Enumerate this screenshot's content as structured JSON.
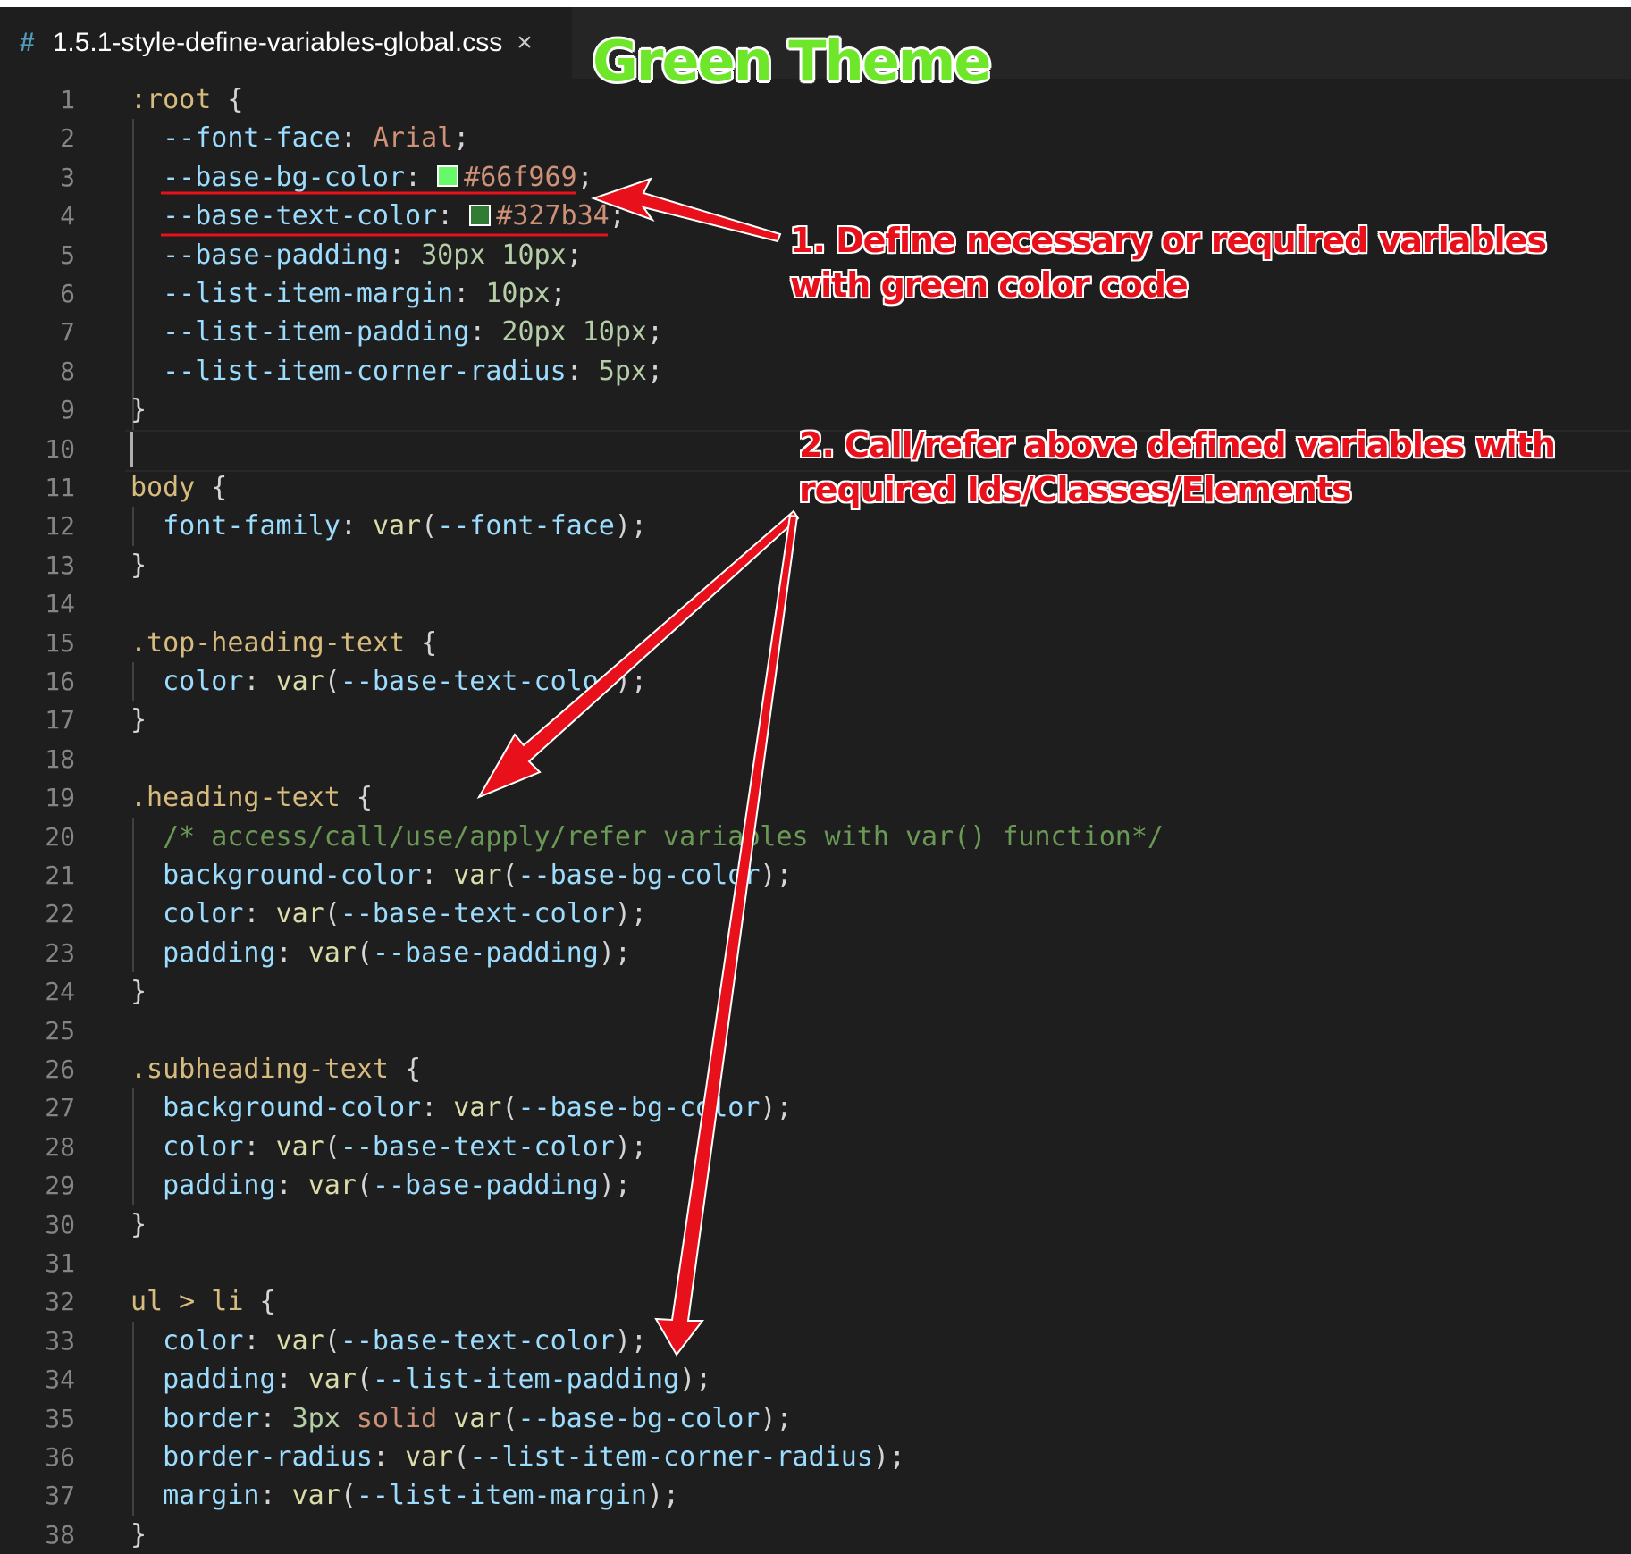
{
  "tab": {
    "icon": "css-hash-icon",
    "hash": "#",
    "filename": "1.5.1-style-define-variables-global.css",
    "close": "×"
  },
  "theme_label": "Green Theme",
  "annotations": {
    "note1_line1": "1.  Define necessary or required variables",
    "note1_line2": "with green color code",
    "note2_line1": "2. Call/refer above defined variables with",
    "note2_line2": "required Ids/Classes/Elements",
    "color": "#e8101a"
  },
  "swatches": {
    "base_bg": "#66f969",
    "base_text": "#327b34"
  },
  "lines": [
    {
      "n": "1",
      "t": [
        [
          ":root",
          "sel"
        ],
        [
          " {",
          "punc"
        ]
      ]
    },
    {
      "n": "2",
      "t": [
        [
          "  --font-face",
          "prop"
        ],
        [
          ": ",
          "punc"
        ],
        [
          "Arial",
          "val"
        ],
        [
          ";",
          "punc"
        ]
      ]
    },
    {
      "n": "3",
      "t": [
        [
          "  --base-bg-color",
          "prop"
        ],
        [
          ": ",
          "punc"
        ],
        [
          "#66f969",
          "val",
          "#66f969"
        ],
        [
          ";",
          "punc"
        ]
      ]
    },
    {
      "n": "4",
      "t": [
        [
          "  --base-text-color",
          "prop"
        ],
        [
          ": ",
          "punc"
        ],
        [
          "#327b34",
          "val",
          "#327b34"
        ],
        [
          ";",
          "punc"
        ]
      ]
    },
    {
      "n": "5",
      "t": [
        [
          "  --base-padding",
          "prop"
        ],
        [
          ": ",
          "punc"
        ],
        [
          "30px 10px",
          "num"
        ],
        [
          ";",
          "punc"
        ]
      ]
    },
    {
      "n": "6",
      "t": [
        [
          "  --list-item-margin",
          "prop"
        ],
        [
          ": ",
          "punc"
        ],
        [
          "10px",
          "num"
        ],
        [
          ";",
          "punc"
        ]
      ]
    },
    {
      "n": "7",
      "t": [
        [
          "  --list-item-padding",
          "prop"
        ],
        [
          ": ",
          "punc"
        ],
        [
          "20px 10px",
          "num"
        ],
        [
          ";",
          "punc"
        ]
      ]
    },
    {
      "n": "8",
      "t": [
        [
          "  --list-item-corner-radius",
          "prop"
        ],
        [
          ": ",
          "punc"
        ],
        [
          "5px",
          "num"
        ],
        [
          ";",
          "punc"
        ]
      ]
    },
    {
      "n": "9",
      "t": [
        [
          "}",
          "punc"
        ]
      ]
    },
    {
      "n": "10",
      "t": []
    },
    {
      "n": "11",
      "t": [
        [
          "body",
          "sel"
        ],
        [
          " {",
          "punc"
        ]
      ]
    },
    {
      "n": "12",
      "t": [
        [
          "  font-family",
          "prop"
        ],
        [
          ": ",
          "punc"
        ],
        [
          "var",
          "fn"
        ],
        [
          "(",
          "punc"
        ],
        [
          "--font-face",
          "prop"
        ],
        [
          ");",
          "punc"
        ]
      ]
    },
    {
      "n": "13",
      "t": [
        [
          "}",
          "punc"
        ]
      ]
    },
    {
      "n": "14",
      "t": []
    },
    {
      "n": "15",
      "t": [
        [
          ".top-heading-text",
          "sel"
        ],
        [
          " {",
          "punc"
        ]
      ]
    },
    {
      "n": "16",
      "t": [
        [
          "  color",
          "prop"
        ],
        [
          ": ",
          "punc"
        ],
        [
          "var",
          "fn"
        ],
        [
          "(",
          "punc"
        ],
        [
          "--base-text-color",
          "prop"
        ],
        [
          ");",
          "punc"
        ]
      ]
    },
    {
      "n": "17",
      "t": [
        [
          "}",
          "punc"
        ]
      ]
    },
    {
      "n": "18",
      "t": []
    },
    {
      "n": "19",
      "t": [
        [
          ".heading-text",
          "sel"
        ],
        [
          " {",
          "punc"
        ]
      ]
    },
    {
      "n": "20",
      "t": [
        [
          "  /* access/call/use/apply/refer variables with var() function*/",
          "com"
        ]
      ]
    },
    {
      "n": "21",
      "t": [
        [
          "  background-color",
          "prop"
        ],
        [
          ": ",
          "punc"
        ],
        [
          "var",
          "fn"
        ],
        [
          "(",
          "punc"
        ],
        [
          "--base-bg-color",
          "prop"
        ],
        [
          ");",
          "punc"
        ]
      ]
    },
    {
      "n": "22",
      "t": [
        [
          "  color",
          "prop"
        ],
        [
          ": ",
          "punc"
        ],
        [
          "var",
          "fn"
        ],
        [
          "(",
          "punc"
        ],
        [
          "--base-text-color",
          "prop"
        ],
        [
          ");",
          "punc"
        ]
      ]
    },
    {
      "n": "23",
      "t": [
        [
          "  padding",
          "prop"
        ],
        [
          ": ",
          "punc"
        ],
        [
          "var",
          "fn"
        ],
        [
          "(",
          "punc"
        ],
        [
          "--base-padding",
          "prop"
        ],
        [
          ");",
          "punc"
        ]
      ]
    },
    {
      "n": "24",
      "t": [
        [
          "}",
          "punc"
        ]
      ]
    },
    {
      "n": "25",
      "t": []
    },
    {
      "n": "26",
      "t": [
        [
          ".subheading-text",
          "sel"
        ],
        [
          " {",
          "punc"
        ]
      ]
    },
    {
      "n": "27",
      "t": [
        [
          "  background-color",
          "prop"
        ],
        [
          ": ",
          "punc"
        ],
        [
          "var",
          "fn"
        ],
        [
          "(",
          "punc"
        ],
        [
          "--base-bg-color",
          "prop"
        ],
        [
          ");",
          "punc"
        ]
      ]
    },
    {
      "n": "28",
      "t": [
        [
          "  color",
          "prop"
        ],
        [
          ": ",
          "punc"
        ],
        [
          "var",
          "fn"
        ],
        [
          "(",
          "punc"
        ],
        [
          "--base-text-color",
          "prop"
        ],
        [
          ");",
          "punc"
        ]
      ]
    },
    {
      "n": "29",
      "t": [
        [
          "  padding",
          "prop"
        ],
        [
          ": ",
          "punc"
        ],
        [
          "var",
          "fn"
        ],
        [
          "(",
          "punc"
        ],
        [
          "--base-padding",
          "prop"
        ],
        [
          ");",
          "punc"
        ]
      ]
    },
    {
      "n": "30",
      "t": [
        [
          "}",
          "punc"
        ]
      ]
    },
    {
      "n": "31",
      "t": []
    },
    {
      "n": "32",
      "t": [
        [
          "ul > li",
          "sel"
        ],
        [
          " {",
          "punc"
        ]
      ]
    },
    {
      "n": "33",
      "t": [
        [
          "  color",
          "prop"
        ],
        [
          ": ",
          "punc"
        ],
        [
          "var",
          "fn"
        ],
        [
          "(",
          "punc"
        ],
        [
          "--base-text-color",
          "prop"
        ],
        [
          ");",
          "punc"
        ]
      ]
    },
    {
      "n": "34",
      "t": [
        [
          "  padding",
          "prop"
        ],
        [
          ": ",
          "punc"
        ],
        [
          "var",
          "fn"
        ],
        [
          "(",
          "punc"
        ],
        [
          "--list-item-padding",
          "prop"
        ],
        [
          ");",
          "punc"
        ]
      ]
    },
    {
      "n": "35",
      "t": [
        [
          "  border",
          "prop"
        ],
        [
          ": ",
          "punc"
        ],
        [
          "3px",
          "num"
        ],
        [
          " solid ",
          "val"
        ],
        [
          "var",
          "fn"
        ],
        [
          "(",
          "punc"
        ],
        [
          "--base-bg-color",
          "prop"
        ],
        [
          ");",
          "punc"
        ]
      ]
    },
    {
      "n": "36",
      "t": [
        [
          "  border-radius",
          "prop"
        ],
        [
          ": ",
          "punc"
        ],
        [
          "var",
          "fn"
        ],
        [
          "(",
          "punc"
        ],
        [
          "--list-item-corner-radius",
          "prop"
        ],
        [
          ");",
          "punc"
        ]
      ]
    },
    {
      "n": "37",
      "t": [
        [
          "  margin",
          "prop"
        ],
        [
          ": ",
          "punc"
        ],
        [
          "var",
          "fn"
        ],
        [
          "(",
          "punc"
        ],
        [
          "--list-item-margin",
          "prop"
        ],
        [
          ");",
          "punc"
        ]
      ]
    },
    {
      "n": "38",
      "t": [
        [
          "}",
          "punc"
        ]
      ]
    }
  ]
}
